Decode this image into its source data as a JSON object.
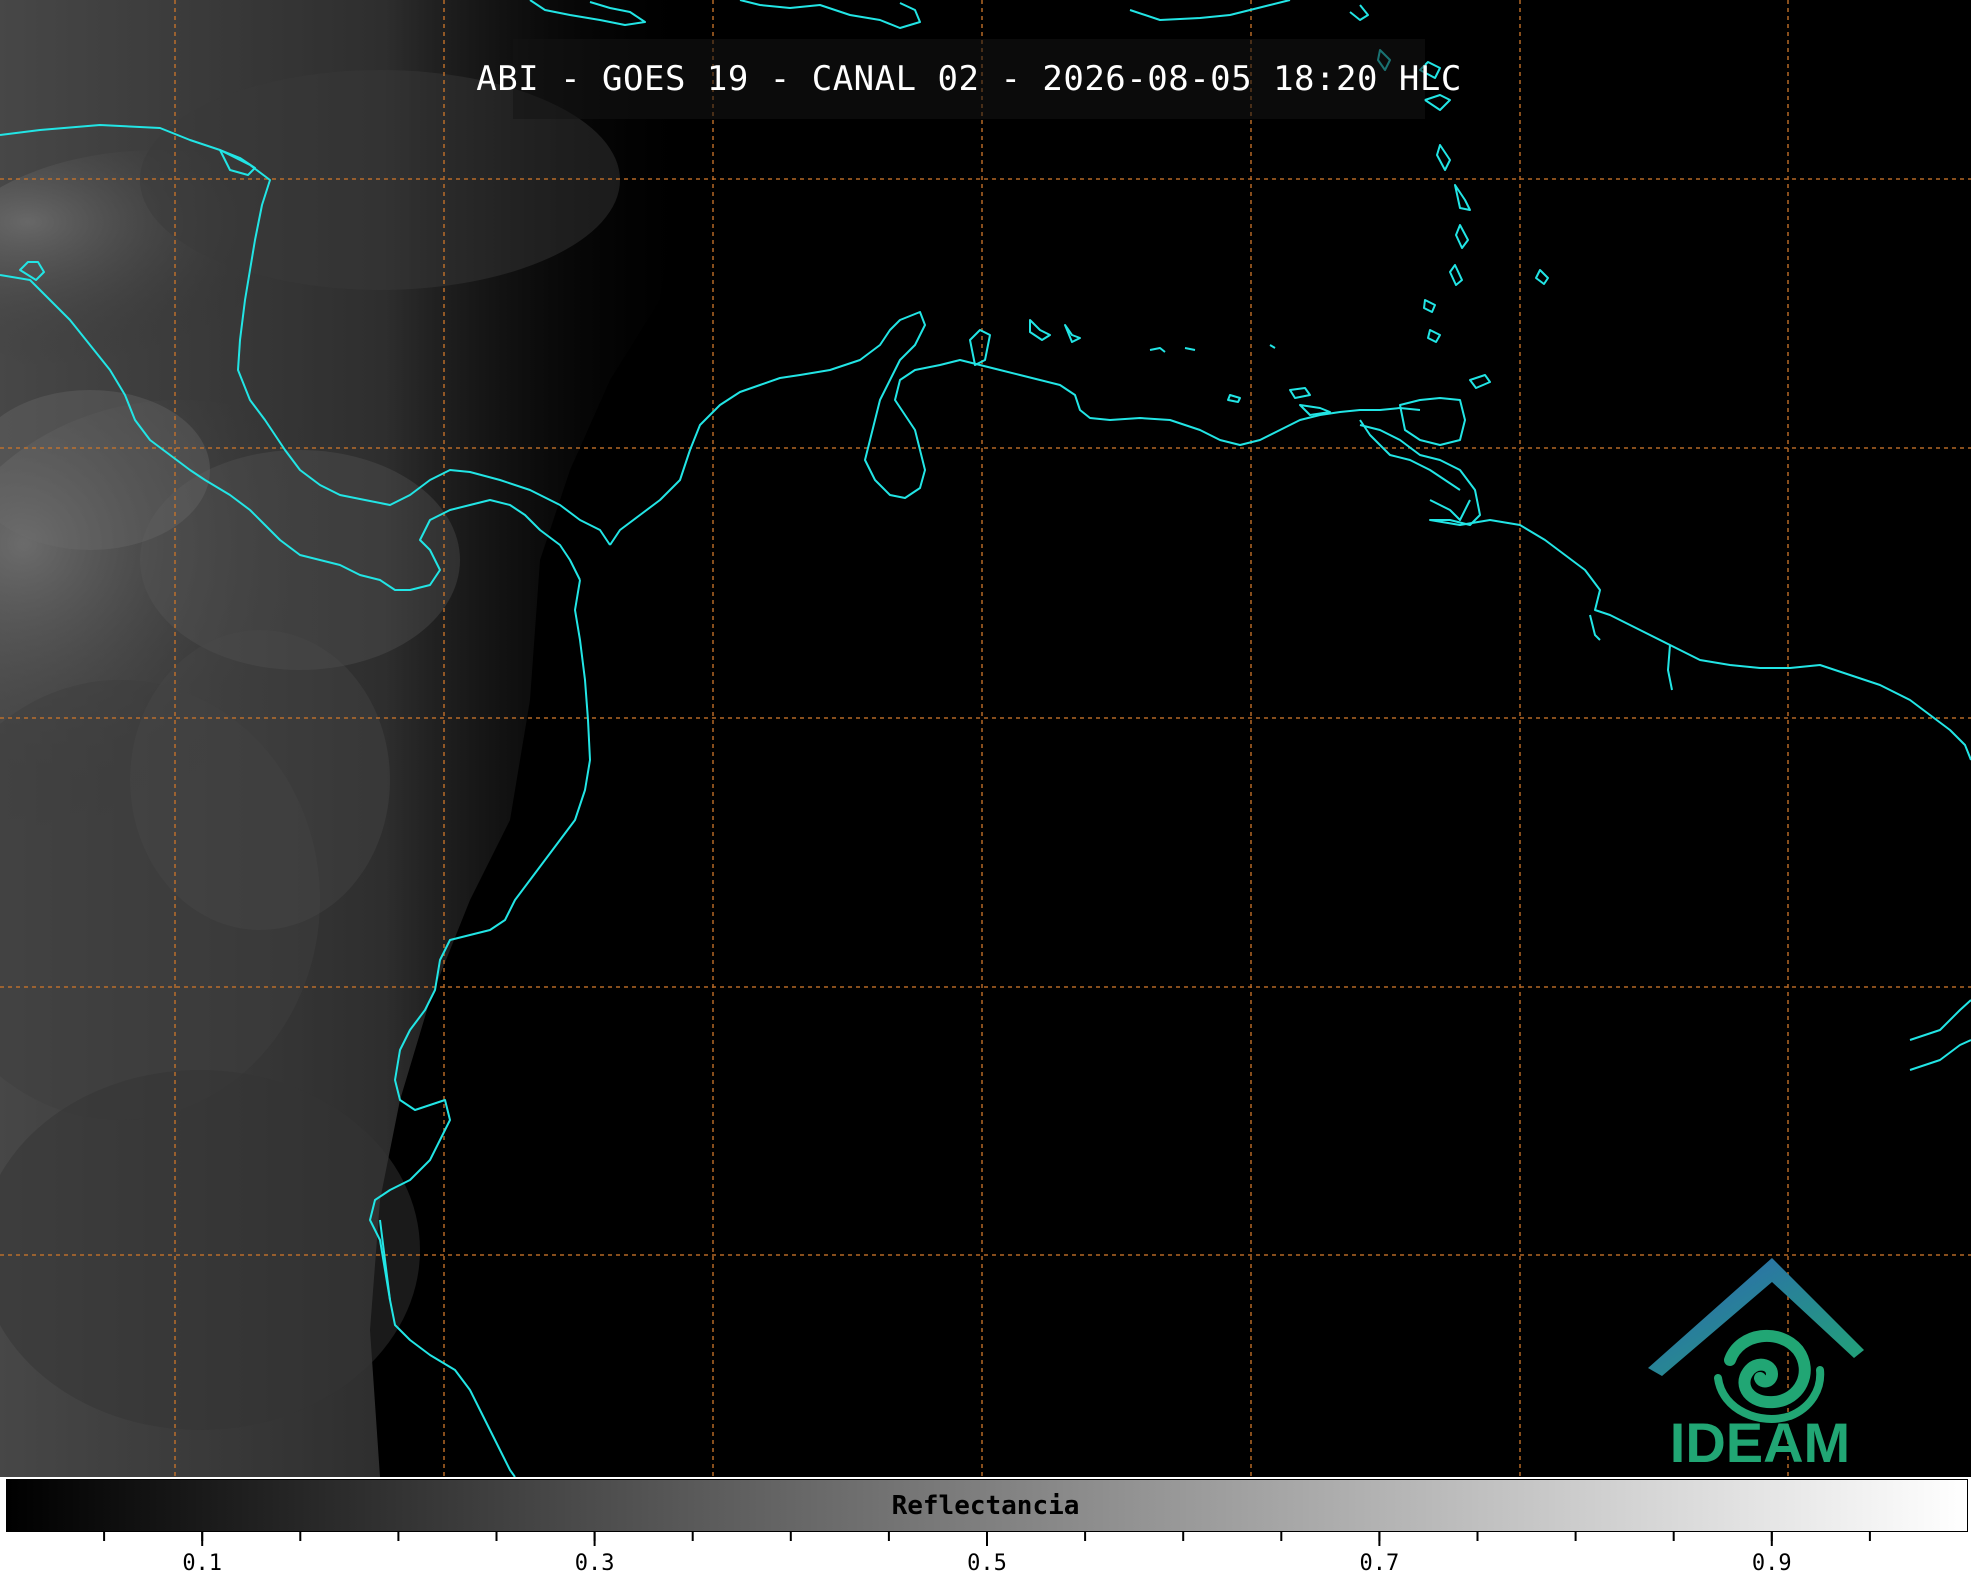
{
  "image": {
    "title": "ABI - GOES 19 - CANAL 02 - 2026-08-05 18:20 HLC",
    "organization": "IDEAM"
  },
  "colorbar": {
    "label": "Reflectancia",
    "range": [
      0,
      1
    ],
    "tick_labels": [
      "0.1",
      "0.3",
      "0.5",
      "0.7",
      "0.9"
    ],
    "colors": {
      "low": "#000000",
      "high": "#ffffff"
    }
  },
  "overlay": {
    "coastline_color": "#22e5e5",
    "gridline_color": "#c8732a"
  },
  "logo": {
    "name": "ideam-logo-icon",
    "colors": [
      "#2e63b6",
      "#21a674"
    ]
  }
}
